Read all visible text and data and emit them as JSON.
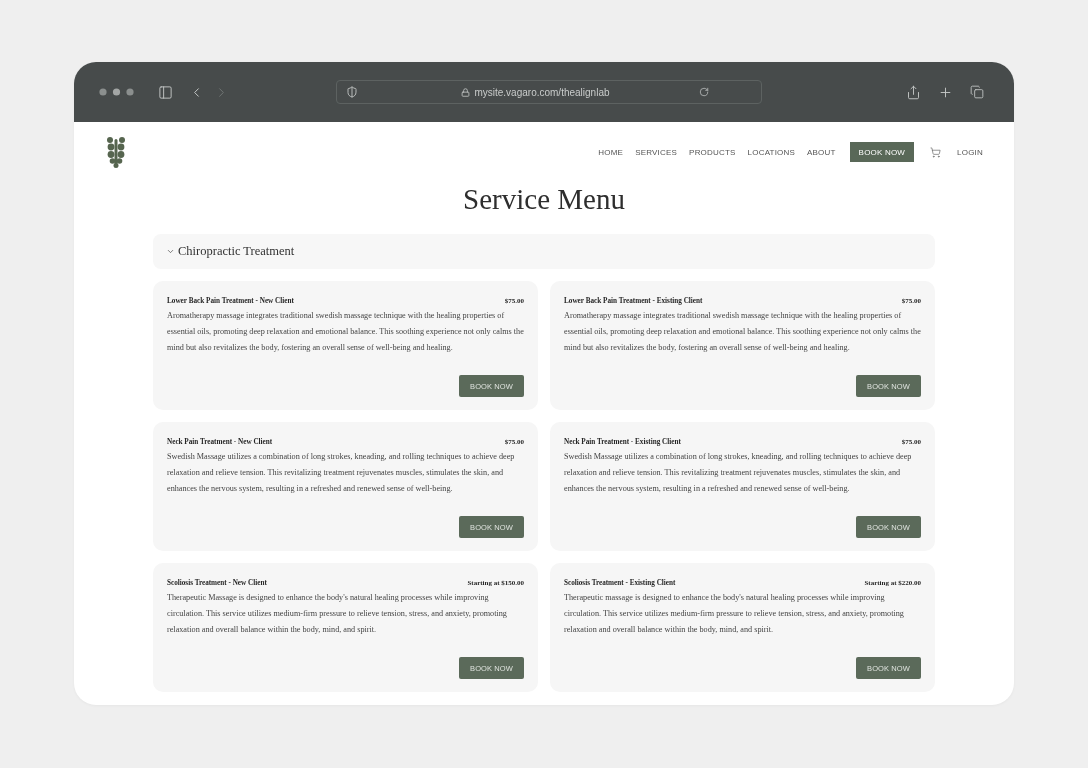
{
  "browser": {
    "url": "mysite.vagaro.com/thealignlab"
  },
  "nav": {
    "items": [
      "HOME",
      "SERVICES",
      "PRODUCTS",
      "LOCATIONS",
      "ABOUT"
    ],
    "cta": "BOOK NOW",
    "login": "LOGIN"
  },
  "page_title": "Service Menu",
  "category": {
    "label": "Chiropractic Treatment",
    "expanded": true
  },
  "services": [
    {
      "name": "Lower Back Pain Treatment - New Client",
      "price": "$75.00",
      "description": "Aromatherapy massage integrates traditional swedish massage technique with the healing properties of essential oils, promoting deep relaxation and emotional balance. This soothing experience not only calms the mind but also revitalizes the body, fostering an overall sense of well-being and healing.",
      "button": "BOOK NOW"
    },
    {
      "name": "Lower Back Pain Treatment - Existing Client",
      "price": "$75.00",
      "description": "Aromatherapy massage integrates traditional swedish massage technique with the healing properties of essential oils, promoting deep relaxation and emotional balance. This soothing experience not only calms the mind but also revitalizes the body, fostering an overall sense of well-being and healing.",
      "button": "BOOK NOW"
    },
    {
      "name": "Neck Pain Treatment - New Client",
      "price": "$75.00",
      "description": "Swedish Massage utilizes a combination of long strokes, kneading, and rolling techniques to achieve deep relaxation and relieve tension. This revitalizing treatment rejuvenates muscles, stimulates the skin, and enhances the nervous system, resulting in a refreshed and renewed sense of well-being.",
      "button": "BOOK NOW"
    },
    {
      "name": "Neck Pain Treatment - Existing Client",
      "price": "$75.00",
      "description": "Swedish Massage utilizes a combination of long strokes, kneading, and rolling techniques to achieve deep relaxation and relieve tension. This revitalizing treatment rejuvenates muscles, stimulates the skin, and enhances the nervous system, resulting in a refreshed and renewed sense of well-being.",
      "button": "BOOK NOW"
    },
    {
      "name": "Scoliosis Treatment - New Client",
      "price": "Starting at $150.00",
      "description": "Therapeutic Massage is designed to enhance the body's natural healing processes while improving circulation. This service utilizes medium-firm pressure to relieve tension, stress, and anxiety, promoting relaxation and overall balance within the body, mind, and spirit.",
      "button": "BOOK NOW"
    },
    {
      "name": "Scoliosis Treatment - Existing Client",
      "price": "Starting at $220.00",
      "description": "Therapeutic massage is designed to enhance the body's natural healing processes while improving circulation. This service utilizes medium-firm pressure to relieve tension, stress, and anxiety, promoting relaxation and overall balance within the body, mind, and spirit.",
      "button": "BOOK NOW"
    }
  ]
}
